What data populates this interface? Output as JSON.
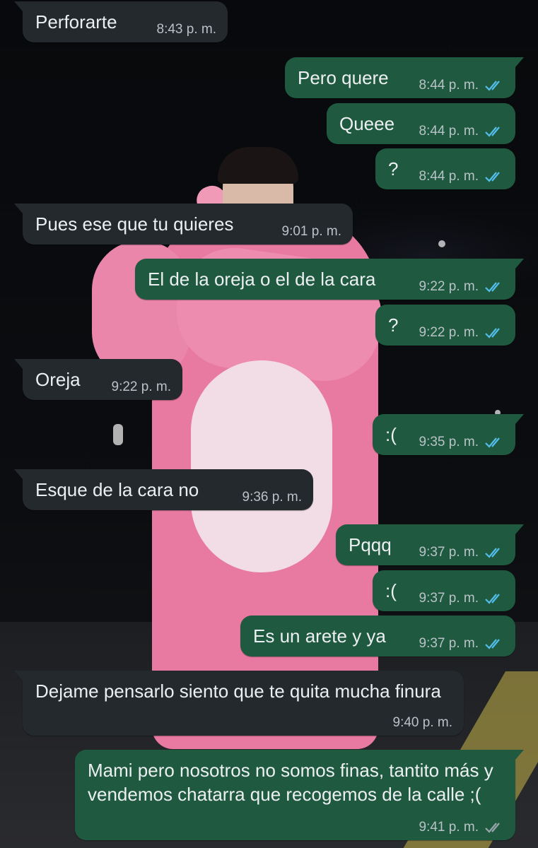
{
  "colors": {
    "incoming_bubble": "#23292d",
    "outgoing_bubble": "#1f5a40",
    "read_ticks": "#53bdeb",
    "delivered_ticks": "#9aa5ab"
  },
  "messages": [
    {
      "direction": "in",
      "text": "Perforarte",
      "time": "8:43 p. m."
    },
    {
      "direction": "out",
      "text": "Pero quere",
      "time": "8:44 p. m.",
      "status": "read"
    },
    {
      "direction": "out",
      "text": "Queee",
      "time": "8:44 p. m.",
      "status": "read"
    },
    {
      "direction": "out",
      "text": "?",
      "time": "8:44 p. m.",
      "status": "read"
    },
    {
      "direction": "in",
      "text": "Pues ese que tu quieres",
      "time": "9:01 p. m."
    },
    {
      "direction": "out",
      "text": "El de la oreja o el de la cara",
      "time": "9:22 p. m.",
      "status": "read"
    },
    {
      "direction": "out",
      "text": "?",
      "time": "9:22 p. m.",
      "status": "read"
    },
    {
      "direction": "in",
      "text": "Oreja",
      "time": "9:22 p. m."
    },
    {
      "direction": "out",
      "text": ":(",
      "time": "9:35 p. m.",
      "status": "read"
    },
    {
      "direction": "in",
      "text": "Esque de la cara no",
      "time": "9:36 p. m."
    },
    {
      "direction": "out",
      "text": "Pqqq",
      "time": "9:37 p. m.",
      "status": "read"
    },
    {
      "direction": "out",
      "text": ":(",
      "time": "9:37 p. m.",
      "status": "read"
    },
    {
      "direction": "out",
      "text": "Es un arete y ya",
      "time": "9:37 p. m.",
      "status": "read"
    },
    {
      "direction": "in",
      "text": "Dejame pensarlo siento que te quita mucha finura",
      "time": "9:40 p. m."
    },
    {
      "direction": "out",
      "text": "Mami pero nosotros no somos finas, tantito más y vendemos chatarra que recogemos de la calle ;(",
      "time": "9:41 p. m.",
      "status": "delivered"
    }
  ]
}
